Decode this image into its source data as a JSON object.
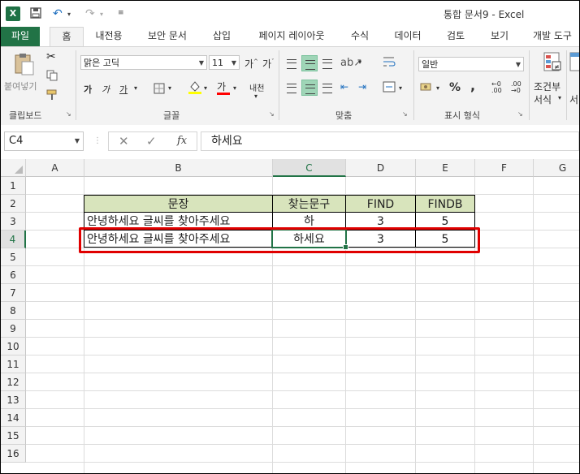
{
  "titlebar": {
    "logo": "X",
    "title": "통합 문서9 - Excel",
    "qa_icons": [
      "save-icon",
      "undo-icon",
      "redo-icon",
      "customize-icon"
    ]
  },
  "tabs": [
    "파일",
    "홈",
    "내전용",
    "보안 문서",
    "삽입",
    "페이지 레이아웃",
    "수식",
    "데이터",
    "검토",
    "보기",
    "개발 도구"
  ],
  "ribbon": {
    "clipboard": {
      "paste_label": "붙여넣기",
      "group_label": "클립보드"
    },
    "font": {
      "font_name": "맑은 고딕",
      "font_size": "11",
      "group_label": "글꼴",
      "font_color": "#ff0000",
      "fill_color": "#ffff00"
    },
    "alignment": {
      "group_label": "맞춤"
    },
    "number": {
      "format": "일반",
      "group_label": "표시 형식",
      "percent": "%",
      "comma": ","
    },
    "styles": {
      "conditional_label_1": "조건부",
      "conditional_label_2": "서식",
      "extra_label": "서"
    }
  },
  "formula_bar": {
    "name_box": "C4",
    "fx_label": "fx",
    "content": "하세요"
  },
  "grid": {
    "columns": [
      "A",
      "B",
      "C",
      "D",
      "E",
      "F",
      "G"
    ],
    "selected_column": "C",
    "rows": [
      "1",
      "2",
      "3",
      "4",
      "5",
      "6",
      "7",
      "8",
      "9",
      "10",
      "11",
      "12",
      "13",
      "14",
      "15",
      "16"
    ],
    "selected_row": "4",
    "header_fill": "#d8e4bc",
    "table": {
      "headers": [
        "문장",
        "찾는문구",
        "FIND",
        "FINDB"
      ],
      "rows": [
        [
          "안녕하세요 글씨를 찾아주세요",
          "하",
          "3",
          "5"
        ],
        [
          "안녕하세요 글씨를 찾아주세요",
          "하세요",
          "3",
          "5"
        ]
      ]
    },
    "highlight_color": "#e00000"
  }
}
